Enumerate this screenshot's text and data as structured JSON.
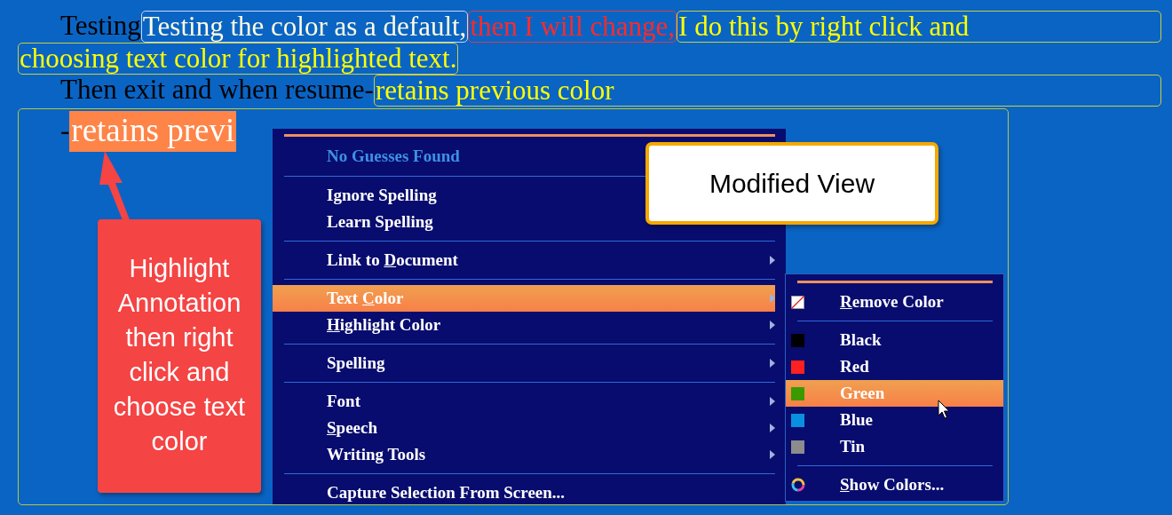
{
  "document": {
    "lines": [
      {
        "runs": [
          {
            "kind": "plain",
            "text": "Testing "
          },
          {
            "kind": "boxed",
            "text": "Testing the color as a default,",
            "color": "#fffde0"
          },
          {
            "kind": "boxed",
            "text": "then I will change,",
            "color": "#ff2a2a"
          },
          {
            "kind": "boxed-fill",
            "text": "I do this by right click and",
            "color": "#ffff00"
          }
        ]
      },
      {
        "runs": [
          {
            "kind": "boxed",
            "text": "choosing text color for highlighted text.",
            "color": "#ffff00"
          }
        ]
      },
      {
        "runs": [
          {
            "kind": "plain",
            "text": "Then exit and when resume-"
          },
          {
            "kind": "boxed-fill",
            "text": "retains previous color",
            "color": "#ffff00"
          }
        ]
      },
      {
        "runs": [
          {
            "kind": "plain",
            "text": "-"
          },
          {
            "kind": "highlight",
            "text": "retains previ",
            "color": "#ff8448"
          }
        ]
      }
    ]
  },
  "menu": {
    "items": [
      {
        "kind": "header",
        "label": "No Guesses Found"
      },
      {
        "kind": "separator"
      },
      {
        "kind": "item",
        "label": "Ignore Spelling",
        "selected": false,
        "submenu": false
      },
      {
        "kind": "item",
        "label": "Learn Spelling",
        "selected": false,
        "submenu": false
      },
      {
        "kind": "separator"
      },
      {
        "kind": "item",
        "parts": [
          {
            "text": "Link to ",
            "underline": false
          },
          {
            "text": "D",
            "underline": true
          },
          {
            "text": "ocument",
            "underline": false
          }
        ],
        "selected": false,
        "submenu": true
      },
      {
        "kind": "separator"
      },
      {
        "kind": "item",
        "parts": [
          {
            "text": "Text ",
            "underline": false
          },
          {
            "text": "C",
            "underline": true
          },
          {
            "text": "olor",
            "underline": false
          }
        ],
        "selected": true,
        "submenu": true
      },
      {
        "kind": "item",
        "parts": [
          {
            "text": "H",
            "underline": true
          },
          {
            "text": "ighlight Color",
            "underline": false
          }
        ],
        "selected": false,
        "submenu": true
      },
      {
        "kind": "separator"
      },
      {
        "kind": "item",
        "label": "Spelling",
        "selected": false,
        "submenu": true
      },
      {
        "kind": "separator"
      },
      {
        "kind": "item",
        "label": "Font",
        "selected": false,
        "submenu": true
      },
      {
        "kind": "item",
        "parts": [
          {
            "text": "S",
            "underline": true
          },
          {
            "text": "peech",
            "underline": false
          }
        ],
        "selected": false,
        "submenu": true
      },
      {
        "kind": "item",
        "label": "Writing Tools",
        "selected": false,
        "submenu": true
      },
      {
        "kind": "separator"
      },
      {
        "kind": "item",
        "label": "Capture Selection From Screen...",
        "selected": false,
        "submenu": false
      }
    ]
  },
  "submenu": {
    "items": [
      {
        "kind": "none",
        "parts": [
          {
            "text": "R",
            "underline": true
          },
          {
            "text": "emove Color",
            "underline": false
          }
        ],
        "selected": false
      },
      {
        "kind": "separator"
      },
      {
        "kind": "swatch",
        "label": "Black",
        "color": "#000000",
        "selected": false
      },
      {
        "kind": "swatch",
        "label": "Red",
        "color": "#ff2020",
        "selected": false
      },
      {
        "kind": "swatch",
        "label": "Green",
        "color": "#3a9a00",
        "selected": true
      },
      {
        "kind": "swatch",
        "label": "Blue",
        "color": "#0a90e0",
        "selected": false
      },
      {
        "kind": "swatch",
        "label": "Tin",
        "color": "#8c8c8c",
        "selected": false
      },
      {
        "kind": "separator"
      },
      {
        "kind": "wheel",
        "parts": [
          {
            "text": "S",
            "underline": true
          },
          {
            "text": "how Colors...",
            "underline": false
          }
        ],
        "selected": false
      }
    ]
  },
  "callout": {
    "text": "Highlight Annotation then right click and choose text color"
  },
  "note": {
    "text": "Modified View"
  }
}
